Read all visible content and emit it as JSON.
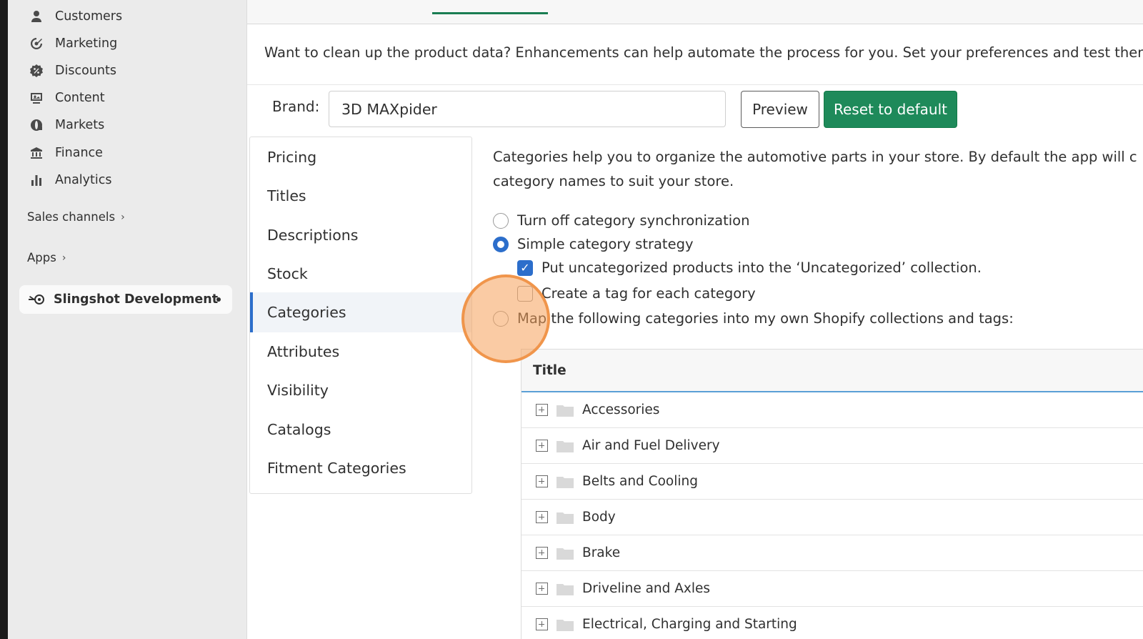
{
  "sidebar": {
    "items": [
      {
        "label": "Customers",
        "icon": "person-icon"
      },
      {
        "label": "Marketing",
        "icon": "target-icon"
      },
      {
        "label": "Discounts",
        "icon": "discount-icon"
      },
      {
        "label": "Content",
        "icon": "content-icon"
      },
      {
        "label": "Markets",
        "icon": "globe-icon"
      },
      {
        "label": "Finance",
        "icon": "bank-icon"
      },
      {
        "label": "Analytics",
        "icon": "bar-chart-icon"
      }
    ],
    "sales_channels": "Sales channels",
    "apps": "Apps",
    "active_app": "Slingshot Development"
  },
  "main": {
    "intro": "Want to clean up the product data? Enhancements can help automate the process for you. Set your preferences and test them",
    "brand_label": "Brand:",
    "brand_value": "3D MAXpider",
    "preview_label": "Preview",
    "reset_label": "Reset to default",
    "menu": [
      "Pricing",
      "Titles",
      "Descriptions",
      "Stock",
      "Categories",
      "Attributes",
      "Visibility",
      "Catalogs",
      "Fitment Categories"
    ],
    "active_menu": "Categories",
    "description_line1": "Categories help you to organize the automotive parts in your store. By default the app will c",
    "description_line2": "category names to suit your store.",
    "options": {
      "off": "Turn off category synchronization",
      "simple": "Simple category strategy",
      "uncategorized": "Put uncategorized products into the ‘Uncategorized’ collection.",
      "tag": "Create a tag for each category",
      "map": "Map the following categories into my own Shopify collections and tags:"
    },
    "selected_option": "simple",
    "uncategorized_checked": true,
    "tag_checked": false,
    "table": {
      "header": "Title",
      "rows": [
        "Accessories",
        "Air and Fuel Delivery",
        "Belts and Cooling",
        "Body",
        "Brake",
        "Driveline and Axles",
        "Electrical, Charging and Starting"
      ]
    }
  },
  "colors": {
    "primary_green": "#1e8a5a",
    "accent_blue": "#2c6ecb",
    "sidebar_bg": "#ebebeb",
    "click_highlight": "#f5a05a"
  }
}
